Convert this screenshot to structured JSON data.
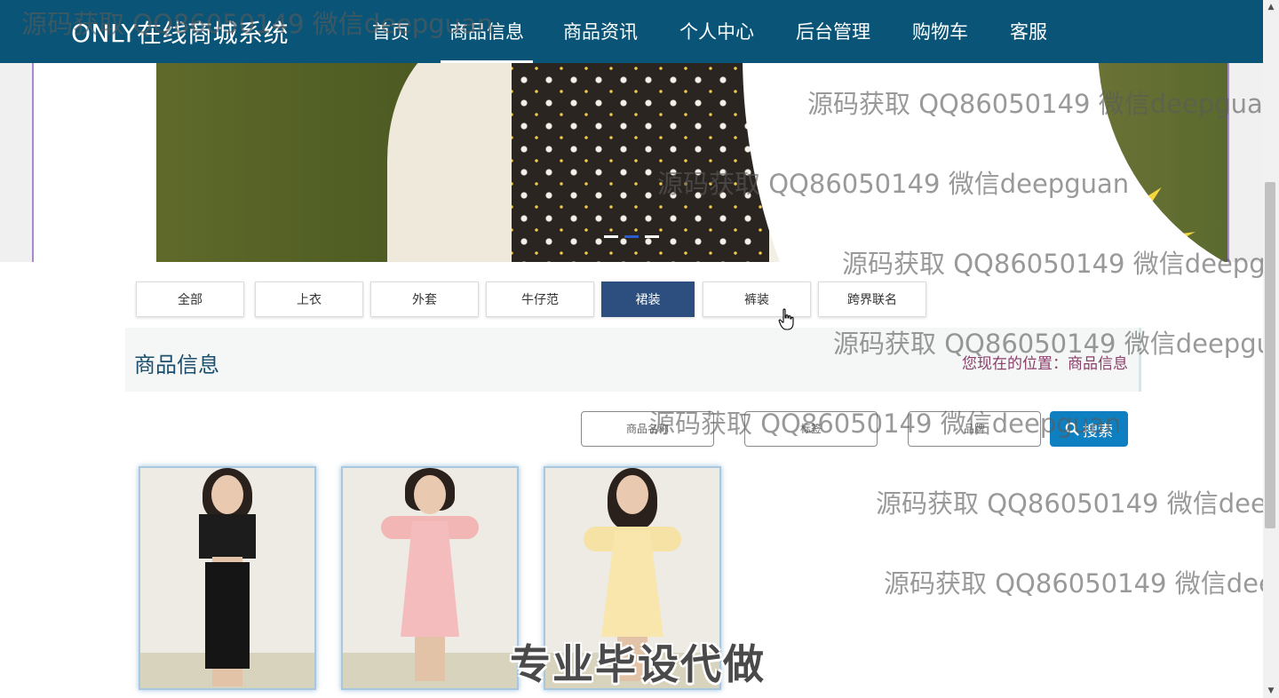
{
  "navbar": {
    "brand": "ONLY在线商城系统",
    "items": [
      {
        "label": "首页"
      },
      {
        "label": "商品信息",
        "active": true
      },
      {
        "label": "商品资讯"
      },
      {
        "label": "个人中心"
      },
      {
        "label": "后台管理"
      },
      {
        "label": "购物车"
      },
      {
        "label": "客服"
      }
    ],
    "bg_color": "#0a5577"
  },
  "banner": {
    "slide_count": 3,
    "active_slide": 2
  },
  "categories": [
    {
      "label": "全部"
    },
    {
      "label": "上衣"
    },
    {
      "label": "外套"
    },
    {
      "label": "牛仔范"
    },
    {
      "label": "裙装",
      "active": true
    },
    {
      "label": "裤装"
    },
    {
      "label": "跨界联名"
    }
  ],
  "section": {
    "title": "商品信息",
    "breadcrumb": "您现在的位置：商品信息"
  },
  "search": {
    "name_placeholder": "商品名称",
    "tag_placeholder": "标签",
    "brand_placeholder": "品牌",
    "button_label": "搜索",
    "button_color": "#0e7fc0"
  },
  "products": [
    {
      "image": "model-black-two-piece"
    },
    {
      "image": "model-pink-dress"
    },
    {
      "image": "model-yellow-dress"
    }
  ],
  "watermarks": [
    "源码获取 QQ86050149 微信deepguan",
    "源码获取 QQ86050149 微信deepguan",
    "源码获取 QQ86050149 微信deepguan",
    "源码获取 QQ86050149 微信deepgu",
    "源码获取 QQ86050149 微信deepgu",
    "源码获取 QQ86050149 微信deepguan",
    "源码获取 QQ86050149 微信deep",
    "源码获取 QQ86050149 微信dee"
  ],
  "caption": "专业毕设代做"
}
